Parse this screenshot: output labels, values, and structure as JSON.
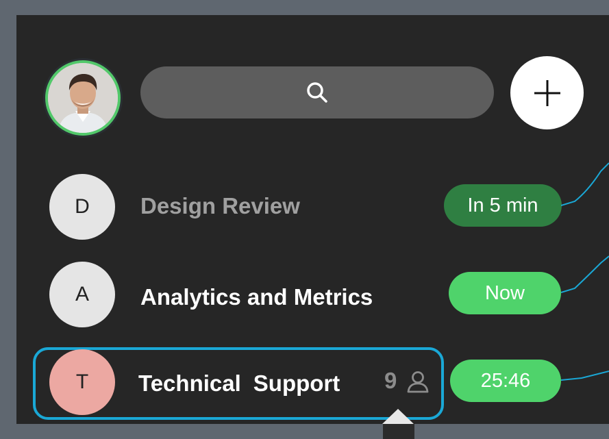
{
  "user": {
    "avatar_icon": "user-avatar-photo",
    "status_color": "#52c86a"
  },
  "search": {
    "icon": "search-icon"
  },
  "add": {
    "icon": "plus-icon"
  },
  "conversations": [
    {
      "initial": "D",
      "title": "Design Review",
      "badge": "In 5 min",
      "badge_color": "#2f7f42",
      "avatar_color": "#e5e5e5",
      "title_color": "#a0a0a0"
    },
    {
      "initial": "A",
      "title": "Analytics and Metrics",
      "badge": "Now",
      "badge_color": "#4fd36b",
      "avatar_color": "#e5e5e5",
      "title_color": "#ffffff"
    },
    {
      "initial": "T",
      "title_part1": "Technical",
      "title_part2": "Support",
      "participant_count": "9",
      "participant_icon": "person-icon",
      "badge": "25:46",
      "badge_color": "#4fd36b",
      "avatar_color": "#eca8a2",
      "title_color": "#ffffff"
    }
  ],
  "accent": "#1aa8d6"
}
